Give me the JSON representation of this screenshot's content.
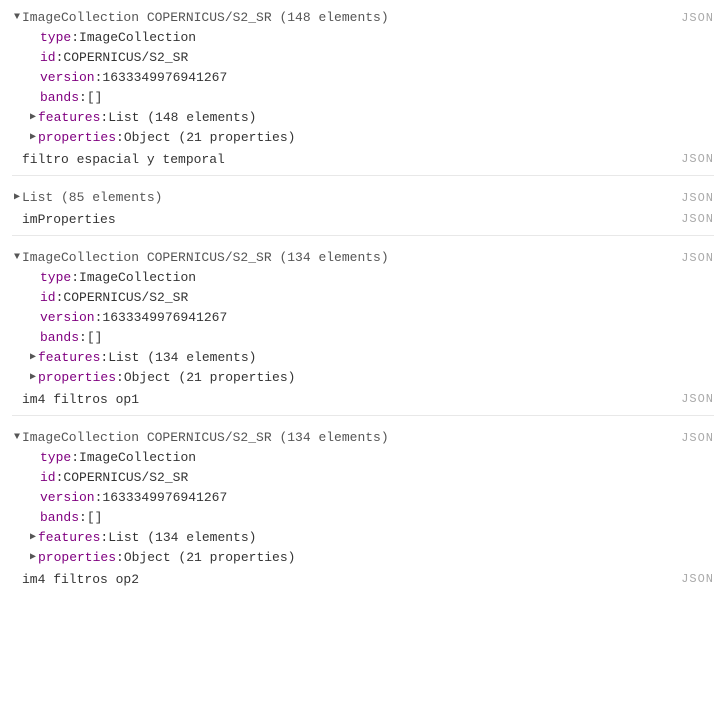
{
  "json_label": "JSON",
  "blocks": [
    {
      "expanded": true,
      "header": "ImageCollection COPERNICUS/S2_SR (148 elements)",
      "props": [
        {
          "tri": "",
          "key": "type",
          "value": "ImageCollection"
        },
        {
          "tri": "",
          "key": "id",
          "value": "COPERNICUS/S2_SR"
        },
        {
          "tri": "",
          "key": "version",
          "value": "1633349976941267"
        },
        {
          "tri": "",
          "key": "bands",
          "value": "[]"
        },
        {
          "tri": "▶",
          "key": "features",
          "value": "List (148 elements)"
        },
        {
          "tri": "▶",
          "key": "properties",
          "value": "Object (21 properties)"
        }
      ],
      "label": "filtro espacial y temporal"
    },
    {
      "expanded": false,
      "header": "List (85 elements)",
      "props": [],
      "label": "imProperties"
    },
    {
      "expanded": true,
      "header": "ImageCollection COPERNICUS/S2_SR (134 elements)",
      "props": [
        {
          "tri": "",
          "key": "type",
          "value": "ImageCollection"
        },
        {
          "tri": "",
          "key": "id",
          "value": "COPERNICUS/S2_SR"
        },
        {
          "tri": "",
          "key": "version",
          "value": "1633349976941267"
        },
        {
          "tri": "",
          "key": "bands",
          "value": "[]"
        },
        {
          "tri": "▶",
          "key": "features",
          "value": "List (134 elements)"
        },
        {
          "tri": "▶",
          "key": "properties",
          "value": "Object (21 properties)"
        }
      ],
      "label": "im4 filtros op1"
    },
    {
      "expanded": true,
      "header": "ImageCollection COPERNICUS/S2_SR (134 elements)",
      "props": [
        {
          "tri": "",
          "key": "type",
          "value": "ImageCollection"
        },
        {
          "tri": "",
          "key": "id",
          "value": "COPERNICUS/S2_SR"
        },
        {
          "tri": "",
          "key": "version",
          "value": "1633349976941267"
        },
        {
          "tri": "",
          "key": "bands",
          "value": "[]"
        },
        {
          "tri": "▶",
          "key": "features",
          "value": "List (134 elements)"
        },
        {
          "tri": "▶",
          "key": "properties",
          "value": "Object (21 properties)"
        }
      ],
      "label": "im4 filtros op2"
    }
  ]
}
